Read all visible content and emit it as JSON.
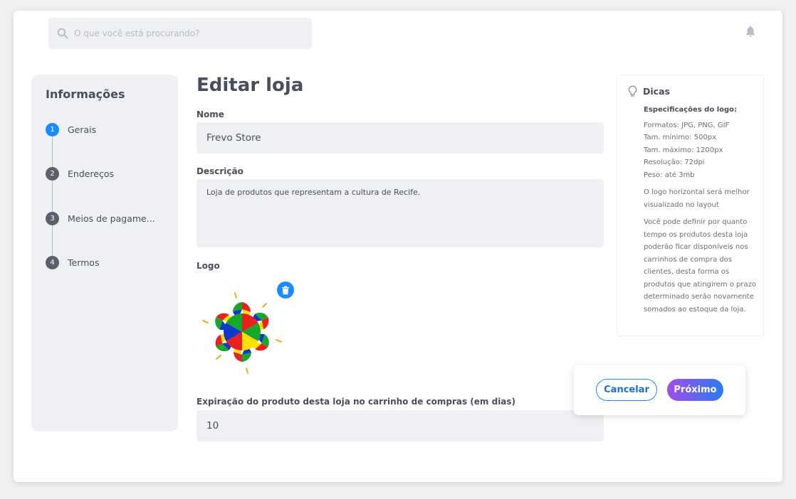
{
  "search": {
    "placeholder": "O que você está procurando?"
  },
  "sidebar": {
    "title": "Informações",
    "steps": [
      {
        "num": "1",
        "label": "Gerais"
      },
      {
        "num": "2",
        "label": "Endereços"
      },
      {
        "num": "3",
        "label": "Meios de pagame..."
      },
      {
        "num": "4",
        "label": "Termos"
      }
    ]
  },
  "form": {
    "title": "Editar loja",
    "name_label": "Nome",
    "name_value": "Frevo Store",
    "description_label": "Descrição",
    "description_value": "Loja de produtos que representam a cultura de Recife.",
    "logo_label": "Logo",
    "expiration_label": "Expiração do produto desta loja no carrinho de compras (em dias)",
    "expiration_value": "10"
  },
  "tips": {
    "title": "Dicas",
    "subtitle": "Especificações do logo:",
    "specs": [
      "Formatos: JPG, PNG, GIF",
      "Tam. mínimo: 500px",
      "Tam. máximo: 1200px",
      "Resolução: 72dpi",
      "Peso: até 3mb"
    ],
    "note1": "O logo horizontal será melhor visualizado no layout",
    "note2": "Você pode definir por quanto tempo os produtos desta loja poderão ficar disponíveis nos carrinhos de compra dos clientes, desta forma os produtos que atingirem o prazo determinado serão novamente somados ao estoque da loja."
  },
  "actions": {
    "cancel": "Cancelar",
    "next": "Próximo"
  },
  "icons": {
    "search": "search-icon",
    "bell": "bell-icon",
    "bulb": "lightbulb-icon",
    "trash": "trash-icon"
  },
  "colors": {
    "accent": "#1a8cff",
    "next_gradient_start": "#a14de8",
    "next_gradient_end": "#2a7bf0"
  }
}
